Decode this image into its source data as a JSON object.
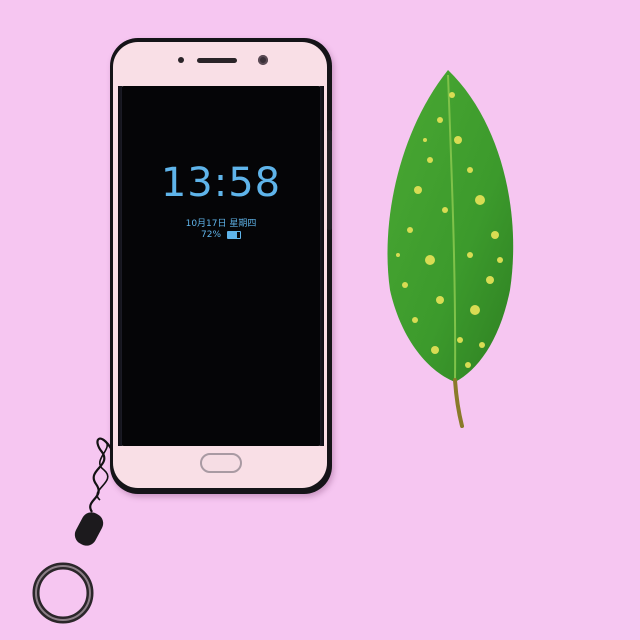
{
  "phone": {
    "lock_screen": {
      "time": "13:58",
      "date": "10月17日 星期四",
      "battery_text": "72%",
      "battery_level": 0.72,
      "text_color": "#5fb4ea"
    },
    "body_color": "#f9dfe6",
    "case_color": "#151418"
  },
  "leaf": {
    "base_color": "#3c9a2c",
    "spot_color": "#d8dc53"
  },
  "background_color": "#f6c6f1"
}
